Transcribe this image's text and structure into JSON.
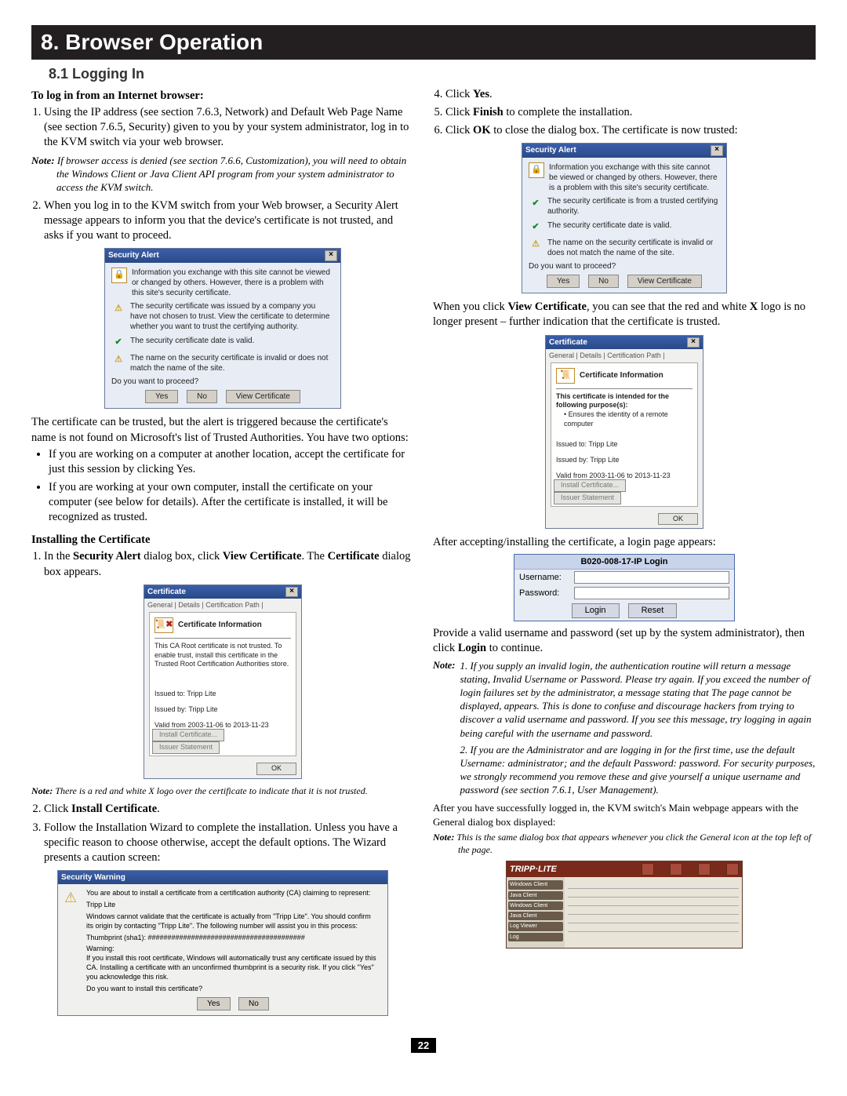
{
  "chapter": "8. Browser Operation",
  "section": "8.1 Logging In",
  "left": {
    "h1": "To log in from an Internet browser:",
    "li1": "Using the IP address (see section 7.6.3, Network) and Default Web Page Name (see section 7.6.5, Security) given to you by your system administrator, log in to the KVM switch via your web browser.",
    "note1_label": "Note:",
    "note1": "If browser access is denied (see section 7.6.6, Customization), you will need to obtain the Windows Client or Java Client API program from your system administrator to access the KVM switch.",
    "li2": "When you log in to the KVM switch from your Web browser, a Security Alert message appears to inform you that the device's certificate is not trusted, and asks if you want to proceed.",
    "dlg1": {
      "title": "Security Alert",
      "intro": "Information you exchange with this site cannot be viewed or changed by others. However, there is a problem with this site's security certificate.",
      "warn1": "The security certificate was issued by a company you have not chosen to trust. View the certificate to determine whether you want to trust the certifying authority.",
      "ok1": "The security certificate date is valid.",
      "warn2": "The name on the security certificate is invalid or does not match the name of the site.",
      "q": "Do you want to proceed?",
      "yes": "Yes",
      "no": "No",
      "view": "View Certificate"
    },
    "p_after1": "The certificate can be trusted, but the alert is triggered because the certificate's name is not found on Microsoft's list of Trusted Authorities. You have two options:",
    "bul1": "If you are working on a computer at another location, accept the certificate for just this session by clicking Yes.",
    "bul2": "If you are working at your own computer, install the certificate on your computer (see below for details). After the certificate is installed, it will be recognized as trusted.",
    "h2": "Installing the Certificate",
    "inst_li1_a": "In the ",
    "inst_li1_b": "Security Alert",
    "inst_li1_c": " dialog box, click ",
    "inst_li1_d": "View Certificate",
    "inst_li1_e": ". The ",
    "inst_li1_f": "Certificate",
    "inst_li1_g": " dialog box appears.",
    "cert": {
      "tabs": "General | Details | Certification Path |",
      "heading": "Certificate Information",
      "msg": "This CA Root certificate is not trusted. To enable trust, install this certificate in the Trusted Root Certification Authorities store.",
      "issued_to": "Issued to:  Tripp Lite",
      "issued_by": "Issued by:  Tripp Lite",
      "valid": "Valid from 2003-11-06 to 2013-11-23",
      "btn1": "Install Certificate...",
      "btn2": "Issuer Statement",
      "ok": "OK"
    },
    "note2_label": "Note:",
    "note2": "There is a red and white X logo over the certificate to indicate that it is not trusted.",
    "inst_li2_a": "Click ",
    "inst_li2_b": "Install Certificate",
    "inst_li2_c": ".",
    "inst_li3": "Follow the Installation Wizard to complete the installation. Unless you have a specific reason to choose otherwise, accept the default options. The Wizard presents a caution screen:",
    "secwarn": {
      "title": "Security Warning",
      "l1": "You are about to install a certificate from a certification authority (CA) claiming to represent:",
      "l2": "Tripp Lite",
      "l3": "Windows cannot validate that the certificate is actually from \"Tripp Lite\". You should confirm its origin by contacting \"Tripp Lite\". The following number will assist you in this process:",
      "l4": "Thumbprint (sha1): ########################################",
      "l5": "Warning:",
      "l6": "If you install this root certificate, Windows will automatically trust any certificate issued by this CA. Installing a certificate with an unconfirmed thumbprint is a security risk. If you click \"Yes\" you acknowledge this risk.",
      "l7": "Do you want to install this certificate?",
      "yes": "Yes",
      "no": "No"
    }
  },
  "right": {
    "li4_a": "Click ",
    "li4_b": "Yes",
    "li4_c": ".",
    "li5_a": "Click ",
    "li5_b": "Finish",
    "li5_c": " to complete the installation.",
    "li6_a": "Click ",
    "li6_b": "OK",
    "li6_c": " to close the dialog box. The certificate is now trusted:",
    "dlg2": {
      "title": "Security Alert",
      "intro": "Information you exchange with this site cannot be viewed or changed by others. However, there is a problem with this site's security certificate.",
      "ok1": "The security certificate is from a trusted certifying authority.",
      "ok2": "The security certificate date is valid.",
      "warn": "The name on the security certificate is invalid or does not match the name of the site.",
      "q": "Do you want to proceed?",
      "yes": "Yes",
      "no": "No",
      "view": "View Certificate"
    },
    "p_view_a": "When you click ",
    "p_view_b": "View Certificate",
    "p_view_c": ", you can see that the red and white ",
    "p_view_d": "X",
    "p_view_e": " logo is no longer present – further indication that the certificate is trusted.",
    "cert2": {
      "tabs": "General | Details | Certification Path |",
      "heading": "Certificate Information",
      "purpose": "This certificate is intended for the following purpose(s):",
      "purpose_item": "• Ensures the identity of a remote computer",
      "issued_to": "Issued to:  Tripp Lite",
      "issued_by": "Issued by:  Tripp Lite",
      "valid": "Valid from 2003-11-06 to 2013-11-23",
      "btn1": "Install Certificate...",
      "btn2": "Issuer Statement",
      "ok": "OK"
    },
    "p_login": "After accepting/installing the certificate, a login page appears:",
    "login": {
      "title": "B020-008-17-IP Login",
      "user": "Username:",
      "pass": "Password:",
      "login": "Login",
      "reset": "Reset"
    },
    "p_provide_a": "Provide a valid username and password (set up by the system administrator), then click ",
    "p_provide_b": "Login",
    "p_provide_c": " to continue.",
    "note3_label": "Note:",
    "note3_1": "1. If you supply an invalid login, the authentication routine will return a message stating, Invalid Username or Password. Please try again. If you exceed the number of login failures set by the administrator, a message stating that The page cannot be displayed, appears. This is done to confuse and discourage hackers from trying to discover a valid username and password. If you see this message, try logging in again being careful with the username and password.",
    "note3_2": "2. If you are the Administrator and are logging in for the first time, use the default Username: administrator; and the default Password: password. For security purposes, we strongly recommend you remove these and give yourself a unique username and password (see section 7.6.1, User Management).",
    "p_after_login": "After you have successfully logged in, the KVM switch's Main webpage appears with the General dialog box displayed:",
    "note4_label": "Note:",
    "note4": "This is the same dialog box that appears whenever you click the General icon at the top left of the page.",
    "kvm": {
      "logo": "TRIPP·LITE",
      "side": [
        "Windows Client",
        "Java Client",
        "Windows Client",
        "Java Client",
        "Log Viewer",
        "Log"
      ]
    }
  },
  "page_num": "22"
}
